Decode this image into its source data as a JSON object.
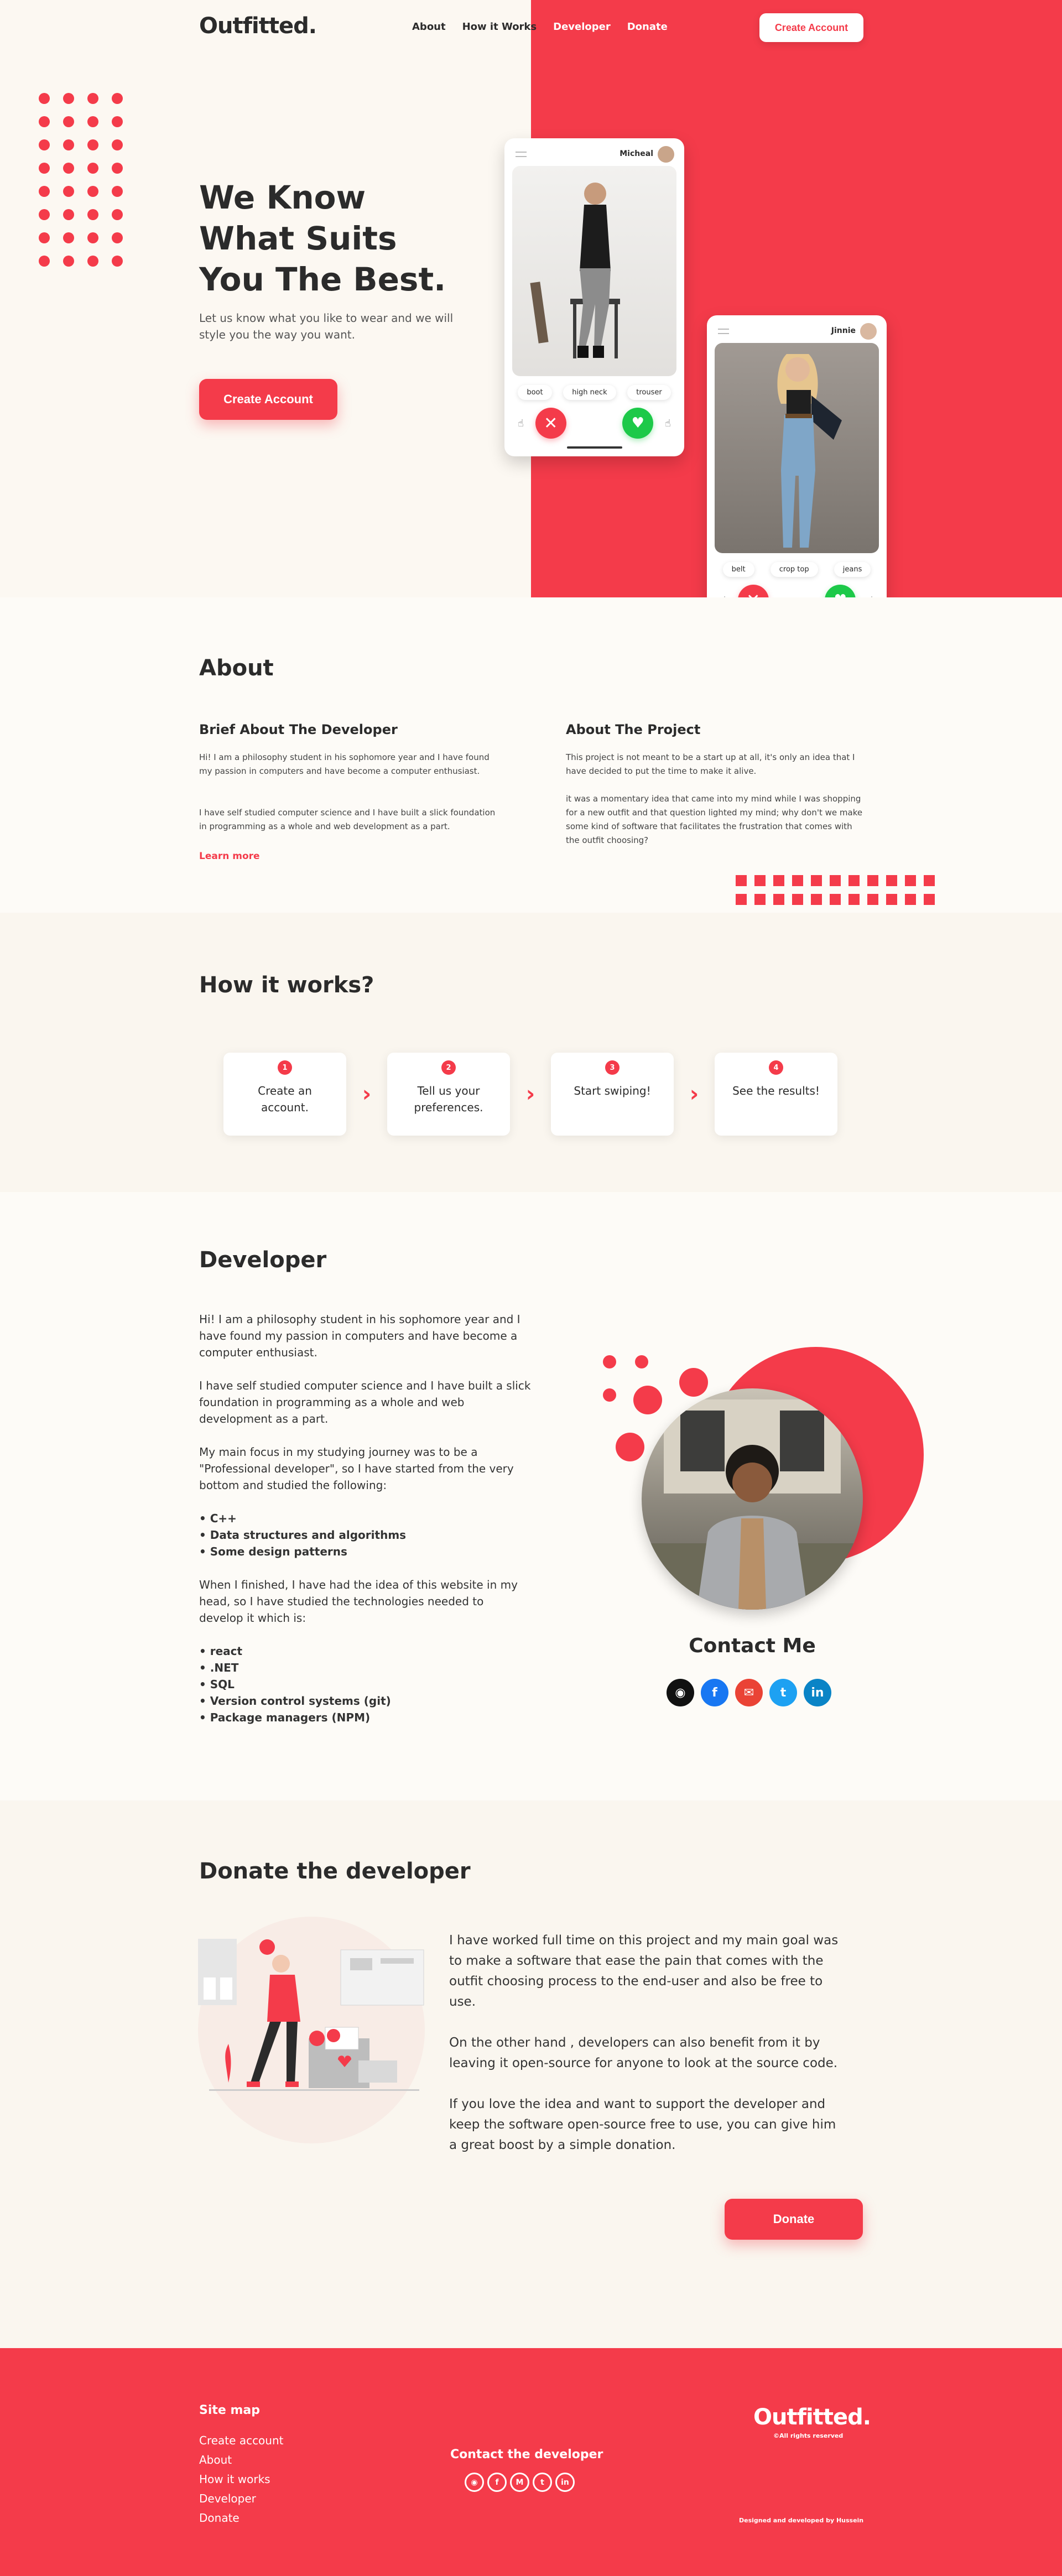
{
  "nav": {
    "logo": "Outfitted.",
    "links": [
      "About",
      "How it Works",
      "Developer",
      "Donate"
    ],
    "cta": "Create Account"
  },
  "hero": {
    "title": "We Know What Suits You The Best.",
    "subtitle": "Let us know what you like to wear and we will style you the way you want.",
    "cta": "Create Account",
    "phone1": {
      "name": "Micheal",
      "tags": [
        "boot",
        "high neck",
        "trouser"
      ]
    },
    "phone2": {
      "name": "Jinnie",
      "tags": [
        "belt",
        "crop top",
        "jeans"
      ]
    }
  },
  "about": {
    "title": "About",
    "dev_heading": "Brief About The Developer",
    "dev_p1": "Hi! I am a philosophy student in his sophomore year and I have found my passion in computers and have become a computer enthusiast.",
    "dev_p2": "I have self studied computer science and I have built a slick foundation in programming as a whole and web development as a part.",
    "learn_more": "Learn more",
    "proj_heading": "About The Project",
    "proj_p1": "This project is not meant to be a start up at all, it's only an idea that I have decided to put the time to make it alive.",
    "proj_p2": "it was a momentary idea that came into my mind while I was shopping for a new outfit and that question lighted my mind; why don't we make some kind of software that facilitates the frustration that comes with the outfit choosing?"
  },
  "how": {
    "title": "How it works?",
    "steps": [
      {
        "num": "1",
        "text": "Create an account."
      },
      {
        "num": "2",
        "text": "Tell us your preferences."
      },
      {
        "num": "3",
        "text": "Start swiping!"
      },
      {
        "num": "4",
        "text": "See the results!"
      }
    ]
  },
  "developer": {
    "title": "Developer",
    "p1": "Hi! I am a philosophy student in his sophomore year and I have found my passion in computers and have become a computer enthusiast.",
    "p2": "I have self studied computer science and I have built a slick foundation in programming as a whole and web development as a part.",
    "p3": "My main focus in my studying journey was to be a \"Professional developer\", so I have started from the very bottom and studied the following:",
    "list1": [
      "• C++",
      "• Data structures and algorithms",
      "• Some design patterns"
    ],
    "p4": "When I finished, I have had the idea of this website in my head, so I have studied the technologies needed to develop it which is:",
    "list2": [
      "• react",
      "• .NET",
      "• SQL",
      "• Version control systems (git)",
      "• Package managers (NPM)"
    ],
    "contact_title": "Contact Me",
    "socials": [
      "github-icon",
      "facebook-icon",
      "gmail-icon",
      "twitter-icon",
      "linkedin-icon"
    ]
  },
  "donate": {
    "title": "Donate the developer",
    "p1": "I have worked full time on this project and my main goal was to make a software that ease the pain that comes with the outfit choosing process to the end-user and also be free to use.",
    "p2": "On the other hand , developers can also benefit from it by leaving it open-source for anyone to look at the source code.",
    "p3": "If you love the idea and want to support the developer and keep the software open-source free to use, you can give him a great boost by a simple donation.",
    "cta": "Donate"
  },
  "footer": {
    "sitemap_title": "Site map",
    "sitemap": [
      "Create account",
      "About",
      "How it works",
      "Developer",
      "Donate"
    ],
    "contact_title": "Contact the developer",
    "logo": "Outfitted.",
    "rights": "©All rights reserved",
    "designed": "Designed and developed by Hussein"
  },
  "colors": {
    "accent": "#f43b4a",
    "like": "#1dc949",
    "bg": "#fcf8f2"
  }
}
